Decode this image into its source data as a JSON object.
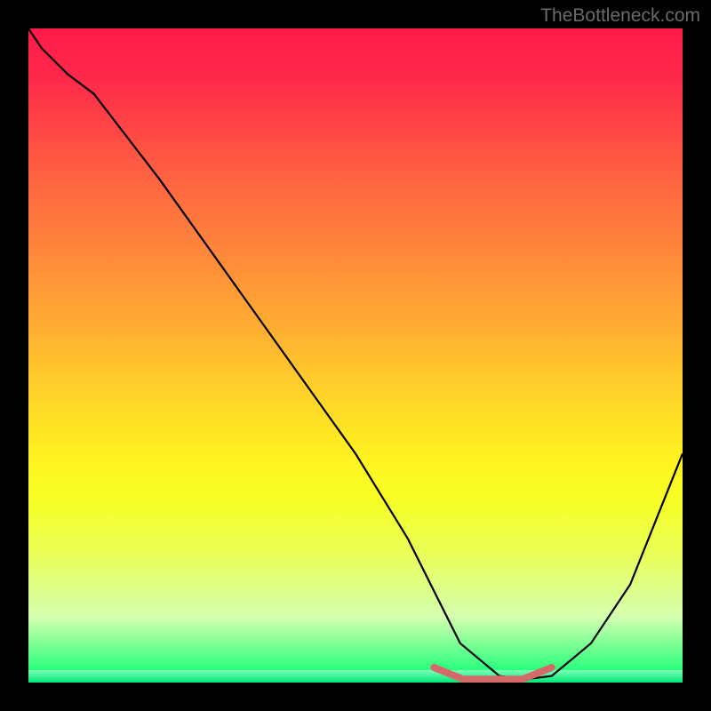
{
  "watermark": "TheBottleneck.com",
  "chart_data": {
    "type": "line",
    "title": "",
    "xlabel": "",
    "ylabel": "",
    "xlim": [
      0,
      100
    ],
    "ylim": [
      0,
      100
    ],
    "series": [
      {
        "name": "bottleneck-curve",
        "x": [
          0,
          2,
          6,
          10,
          20,
          30,
          40,
          50,
          58,
          62,
          66,
          72,
          76,
          80,
          86,
          92,
          100
        ],
        "y": [
          100,
          97,
          93,
          90,
          77,
          63,
          49,
          35,
          22,
          14,
          6,
          1,
          0.5,
          1,
          6,
          15,
          35
        ]
      }
    ],
    "accent": {
      "xstart": 62,
      "xend": 80,
      "y": 1.5,
      "color": "#d46a6a"
    },
    "background_gradient": {
      "top": "#ff1a4a",
      "mid": "#ffd02a",
      "bottom": "#00ff70"
    }
  }
}
